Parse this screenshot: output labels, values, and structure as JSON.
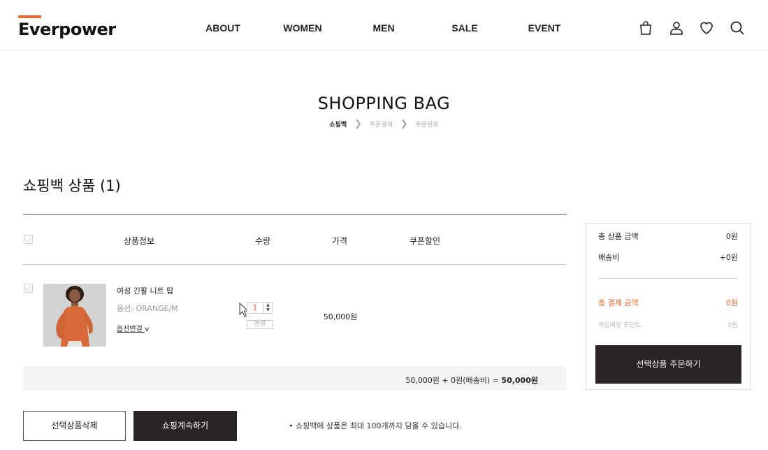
{
  "header": {
    "logo": "Everpower",
    "nav": [
      "ABOUT",
      "WOMEN",
      "MEN",
      "SALE",
      "EVENT"
    ],
    "icons": [
      "shopping-bag-icon",
      "user-icon",
      "heart-icon",
      "search-icon"
    ]
  },
  "page": {
    "title": "SHOPPING BAG",
    "steps": [
      "쇼핑백",
      "주문결제",
      "주문완료"
    ]
  },
  "cart": {
    "section_title": "쇼핑백 상품 (1)",
    "columns": [
      "상품정보",
      "수량",
      "가격",
      "쿠폰할인"
    ],
    "items": [
      {
        "name": "여성 긴팔 니트 탑",
        "option": "옵션: ORANGE/M",
        "option_change": "옵션변경",
        "quantity": "1",
        "change_label": "변경",
        "price": "50,000원"
      }
    ],
    "summary_line_prefix": "50,000원 + 0원(배송비) = ",
    "summary_line_total": "50,000원"
  },
  "buttons": {
    "delete_selected": "선택상품삭제",
    "continue_shopping": "쇼핑계속하기"
  },
  "notice": "•  쇼핑백에 상품은 최대 100개까지 담을 수 있습니다.",
  "summary": {
    "total_product_label": "총 상품 금액",
    "total_product_value": "0원",
    "shipping_label": "배송비",
    "shipping_value": "+0원",
    "total_payment_label": "총 결제 금액",
    "total_payment_value": "0원",
    "points_label": "적립예정 포인트",
    "points_value": "0원",
    "order_button": "선택상품 주문하기"
  },
  "colors": {
    "accent": "#e8692f",
    "dark_button": "#2b2424"
  }
}
